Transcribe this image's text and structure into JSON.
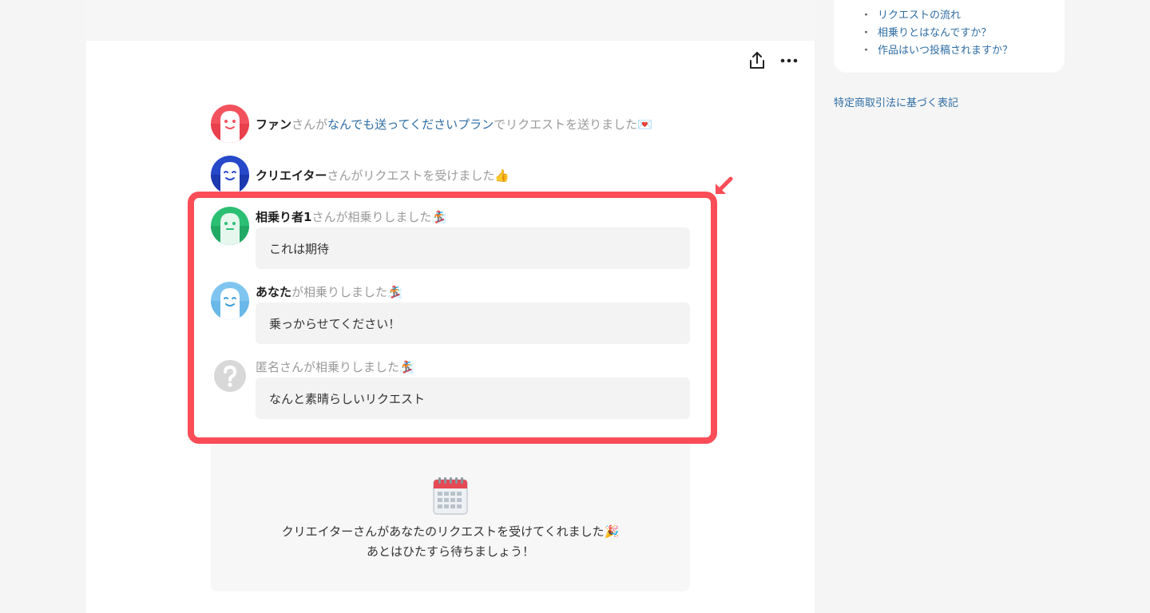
{
  "header": {
    "share_icon": "share-icon",
    "more_icon": "more-dots-icon"
  },
  "timeline": {
    "fan": {
      "name": "ファン",
      "suffix": "さんが",
      "plan": "なんでも送ってくださいプラン",
      "action": "でリクエストを送りました💌"
    },
    "creator": {
      "name": "クリエイター",
      "action": "さんがリクエストを受けました👍"
    }
  },
  "riders": [
    {
      "name": "相乗り者1",
      "action": "さんが相乗りしました🏂",
      "comment": "これは期待"
    },
    {
      "name": "あなた",
      "action": "が相乗りしました🏂",
      "comment": "乗っからせてください！"
    },
    {
      "name": "",
      "action": "匿名さんが相乗りしました🏂",
      "comment": "なんと素晴らしいリクエスト"
    }
  ],
  "calendar": {
    "line1": "クリエイターさんがあなたのリクエストを受けてくれました🎉",
    "line2": "あとはひたすら待ちましょう！"
  },
  "sidebar": {
    "faq": [
      "リクエストの流れ",
      "相乗りとはなんですか？",
      "作品はいつ投稿されますか？"
    ],
    "bullet": "・",
    "legal_link": "特定商取引法に基づく表記"
  },
  "colors": {
    "highlight": "#fa4d57",
    "link": "#2e6da4",
    "fan_avatar": "#f2525d",
    "creator_avatar": "#2648c9",
    "rider_avatar": "#2bbf74",
    "you_avatar": "#7fc5f0"
  }
}
